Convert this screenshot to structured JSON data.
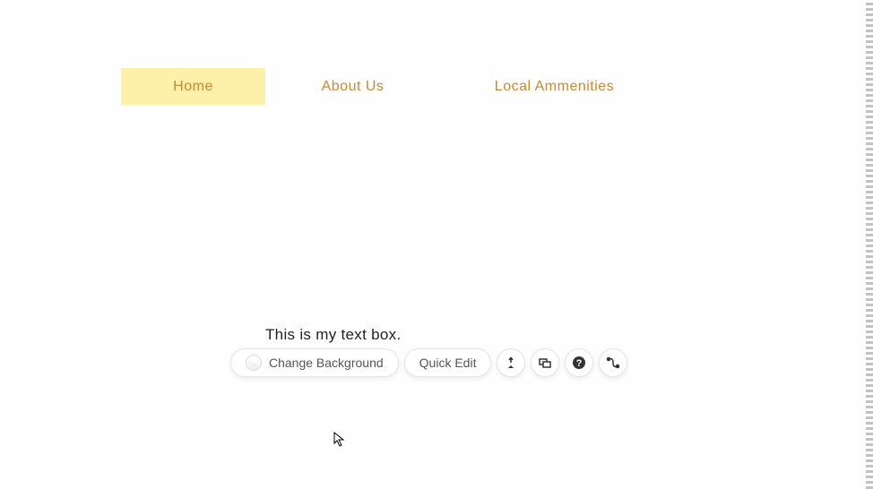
{
  "nav": {
    "items": [
      {
        "label": "Home",
        "active": true
      },
      {
        "label": "About Us",
        "active": false
      },
      {
        "label": "Local Ammenities",
        "active": false
      }
    ]
  },
  "textbox": {
    "content": "This is my text box."
  },
  "toolbar": {
    "change_bg_label": "Change Background",
    "quick_edit_label": "Quick Edit"
  }
}
